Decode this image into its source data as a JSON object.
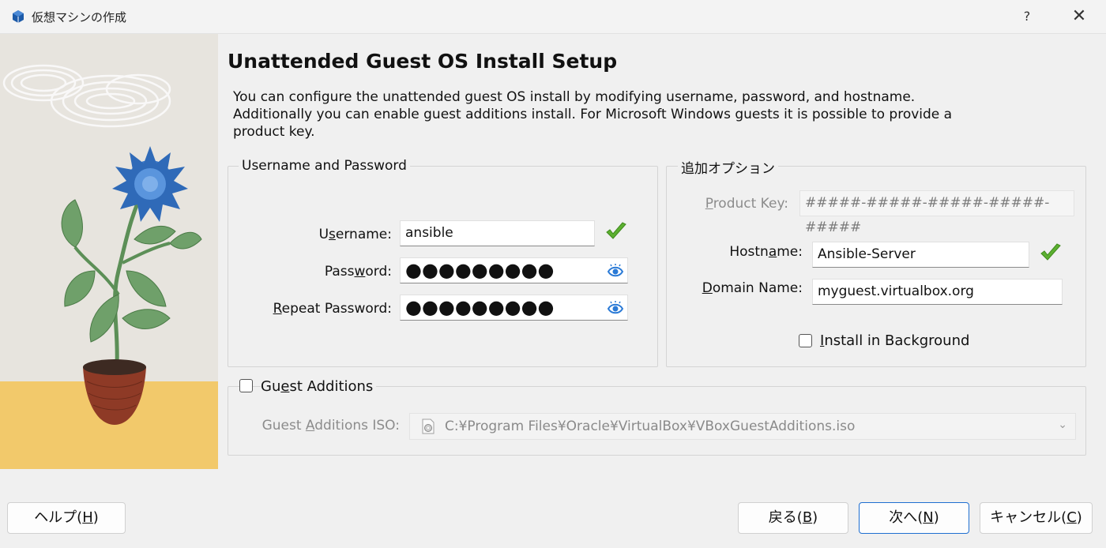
{
  "window": {
    "title": "仮想マシンの作成",
    "help_glyph": "?",
    "close_glyph": "✕"
  },
  "page": {
    "title": "Unattended Guest OS Install Setup",
    "description": "You can configure the unattended guest OS install by modifying username, password, and hostname. Additionally you can enable guest additions install. For Microsoft Windows guests it is possible to provide a product key."
  },
  "credentials": {
    "group_title": "Username and Password",
    "username_label_pre": "U",
    "username_label_mn": "s",
    "username_label_post": "ername:",
    "username_value": "ansible",
    "password_label_pre": "Pass",
    "password_label_mn": "w",
    "password_label_post": "ord:",
    "password_value": "●●●●●●●●●",
    "repeat_label_mn": "R",
    "repeat_label_post": "epeat Password:",
    "repeat_value": "●●●●●●●●●"
  },
  "additional": {
    "group_title": "追加オプション",
    "product_key_label_mn": "P",
    "product_key_label_post": "roduct Key:",
    "product_key_placeholder": "#####-#####-#####-#####-#####",
    "hostname_label_pre": "Hostn",
    "hostname_label_mn": "a",
    "hostname_label_post": "me:",
    "hostname_value": "Ansible-Server",
    "domain_label_mn": "D",
    "domain_label_post": "omain Name:",
    "domain_value": "myguest.virtualbox.org",
    "install_bg_label_mn": "I",
    "install_bg_label_post": "nstall in Background",
    "install_bg_checked": false
  },
  "guest_additions": {
    "label_pre": "Gu",
    "label_mn": "e",
    "label_post": "st Additions",
    "checked": false,
    "iso_label_pre": "Guest ",
    "iso_label_mn": "A",
    "iso_label_post": "dditions ISO:",
    "iso_path": "C:¥Program Files¥Oracle¥VirtualBox¥VBoxGuestAdditions.iso"
  },
  "footer": {
    "help_pre": "ヘルプ(",
    "help_mn": "H",
    "help_post": ")",
    "back_pre": "戻る(",
    "back_mn": "B",
    "back_post": ")",
    "next_pre": "次へ(",
    "next_mn": "N",
    "next_post": ")",
    "cancel_pre": "キャンセル(",
    "cancel_mn": "C",
    "cancel_post": ")"
  },
  "colors": {
    "accent": "#1f6fd1",
    "ok_green": "#5cb030",
    "eye_blue": "#2a7ad6"
  }
}
